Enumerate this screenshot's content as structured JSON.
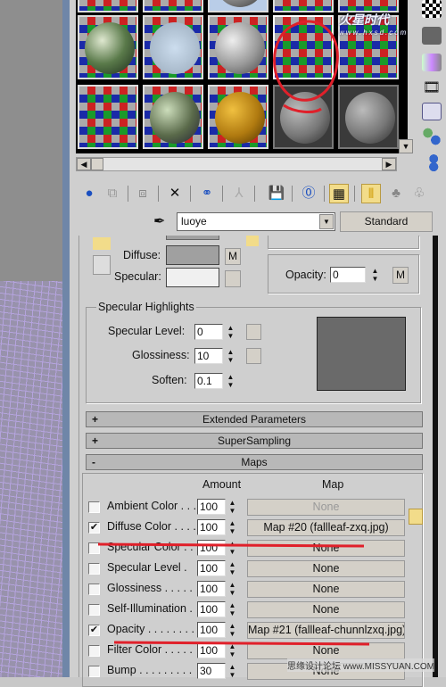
{
  "material_name": "luoye",
  "material_type": "Standard",
  "basic": {
    "diffuse_label": "Diffuse:",
    "specular_label": "Specular:",
    "m_label": "M",
    "opacity_label": "Opacity:",
    "opacity_value": "0"
  },
  "specular_highlights": {
    "title": "Specular Highlights",
    "level_label": "Specular Level:",
    "level": "0",
    "gloss_label": "Glossiness:",
    "gloss": "10",
    "soften_label": "Soften:",
    "soften": "0.1"
  },
  "rollouts": [
    {
      "sign": "+",
      "label": "Extended Parameters"
    },
    {
      "sign": "+",
      "label": "SuperSampling"
    },
    {
      "sign": "-",
      "label": "Maps"
    }
  ],
  "maps": {
    "amount_header": "Amount",
    "map_header": "Map",
    "rows": [
      {
        "label": "Ambient Color . . .",
        "checked": false,
        "amount": "100",
        "map": "None",
        "dim": true
      },
      {
        "label": "Diffuse Color . . . .",
        "checked": true,
        "amount": "100",
        "map": "Map #20 (fallleaf-zxq.jpg)"
      },
      {
        "label": "Specular Color . . .",
        "checked": false,
        "amount": "100",
        "map": "None"
      },
      {
        "label": "Specular Level  .",
        "checked": false,
        "amount": "100",
        "map": "None"
      },
      {
        "label": "Glossiness  . . . . .",
        "checked": false,
        "amount": "100",
        "map": "None"
      },
      {
        "label": "Self-Illumination .",
        "checked": false,
        "amount": "100",
        "map": "None"
      },
      {
        "label": "Opacity . . . . . . . .",
        "checked": true,
        "amount": "100",
        "map": "Map #21 (fallleaf-chunnlzxq.jpg)"
      },
      {
        "label": "Filter Color  . . . . .",
        "checked": false,
        "amount": "100",
        "map": "None"
      },
      {
        "label": "Bump  . . . . . . . . .",
        "checked": false,
        "amount": "30",
        "map": "None"
      }
    ]
  },
  "watermarks": {
    "top": "火星时代",
    "top_url": "www.hxsd.com",
    "bottom": "思缘设计论坛 www.MISSYUAN.COM"
  },
  "colors": {
    "annotation": "#e0202a",
    "diffuse_swatch": "#a0a0a0",
    "specular_swatch": "#f0f0f0",
    "wireframe": "#b9a6e6"
  }
}
